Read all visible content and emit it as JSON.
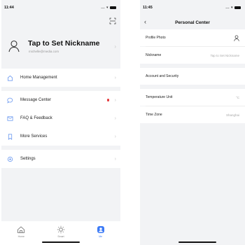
{
  "left": {
    "status": {
      "time": "11:44",
      "signal": "...",
      "wifi": "▾"
    },
    "profile": {
      "nickname": "Tap to Set Nickname",
      "email": "michelle@media.com"
    },
    "menu_group1": [
      {
        "label": "Home Management"
      }
    ],
    "menu_group2": [
      {
        "label": "Message Center"
      },
      {
        "label": "FAQ & Feedback"
      },
      {
        "label": "More Services"
      }
    ],
    "menu_group3": [
      {
        "label": "Settings"
      }
    ],
    "tabs": [
      {
        "label": "Home"
      },
      {
        "label": "Smart"
      },
      {
        "label": "Me"
      }
    ],
    "colors": {
      "accent": "#3d7bf6",
      "badge": "#e4393c",
      "icon": "#5a8dee"
    }
  },
  "right": {
    "status": {
      "time": "11:45",
      "signal": "...",
      "wifi": "▾"
    },
    "title": "Personal Center",
    "rows1": [
      {
        "label": "Profile Photo",
        "value": ""
      },
      {
        "label": "Nickname",
        "value": "Tap to Set Nickname"
      }
    ],
    "rows2": [
      {
        "label": "Account and Security",
        "value": ""
      }
    ],
    "rows3": [
      {
        "label": "Temperature Unit",
        "value": "°C"
      },
      {
        "label": "Time Zone",
        "value": "Shanghai"
      }
    ]
  }
}
